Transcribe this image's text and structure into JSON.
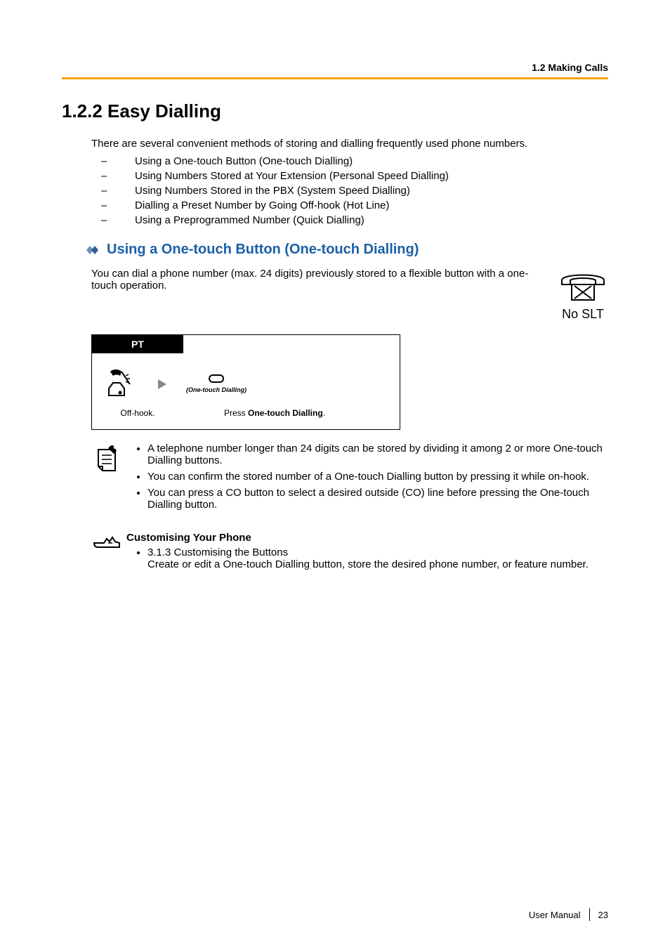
{
  "header": {
    "section": "1.2 Making Calls"
  },
  "title": "1.2.2    Easy Dialling",
  "intro": "There are several convenient methods of storing and dialling frequently used phone numbers.",
  "methods": [
    "Using a One-touch Button (One-touch Dialling)",
    "Using Numbers Stored at Your Extension (Personal Speed Dialling)",
    "Using Numbers Stored in the PBX (System Speed Dialling)",
    "Dialling a Preset Number by Going Off-hook (Hot Line)",
    "Using a Preprogrammed Number (Quick Dialling)"
  ],
  "subheading": "Using a One-touch Button (One-touch Dialling)",
  "sub_para": "You can dial a phone number (max. 24 digits) previously stored to a flexible button with a one-touch operation.",
  "no_slt": "No SLT",
  "procedure": {
    "tab": "PT",
    "button_label": "(One-touch Dialling)",
    "caption1": "Off-hook.",
    "caption2_prefix": "Press ",
    "caption2_bold": "One-touch Dialling",
    "caption2_suffix": "."
  },
  "notes": [
    "A telephone number longer than 24 digits can be stored by dividing it among 2 or more One-touch Dialling buttons.",
    "You can confirm the stored number of a One-touch Dialling button by pressing it while on-hook.",
    "You can press a CO button to select a desired outside (CO) line before pressing the One-touch Dialling button."
  ],
  "customise": {
    "title": "Customising Your Phone",
    "link": "3.1.3 Customising the Buttons",
    "desc": "Create or edit a One-touch Dialling button, store the desired phone number, or feature number."
  },
  "footer": {
    "label": "User Manual",
    "page": "23"
  }
}
